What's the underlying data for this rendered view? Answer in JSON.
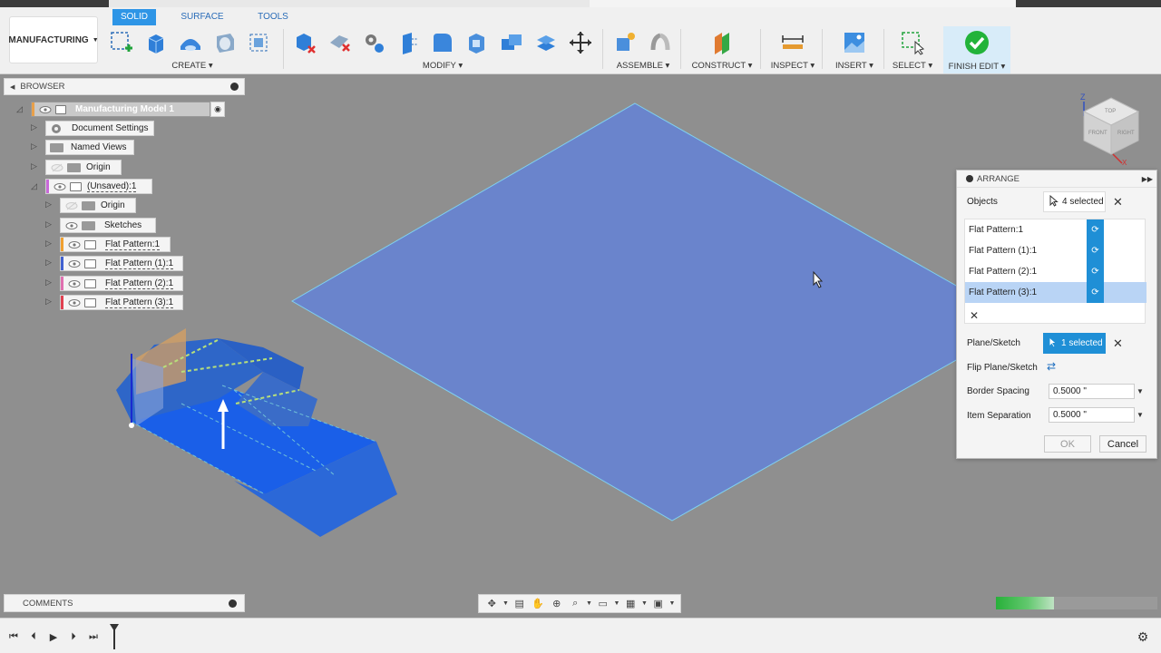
{
  "workspace": {
    "label": "MANUFACTURING"
  },
  "tabs": [
    {
      "label": "SOLID",
      "active": true
    },
    {
      "label": "SURFACE",
      "active": false
    },
    {
      "label": "TOOLS",
      "active": false
    }
  ],
  "groups": {
    "create": "CREATE ▾",
    "modify": "MODIFY ▾",
    "assemble": "ASSEMBLE ▾",
    "construct": "CONSTRUCT ▾",
    "inspect": "INSPECT ▾",
    "insert": "INSERT ▾",
    "select": "SELECT ▾",
    "finish": "FINISH EDIT ▾"
  },
  "browser": {
    "title": "BROWSER",
    "root": "Manufacturing Model 1",
    "items": [
      {
        "label": "Document Settings"
      },
      {
        "label": "Named Views"
      },
      {
        "label": "Origin"
      },
      {
        "label": "(Unsaved):1"
      },
      {
        "label": "Origin"
      },
      {
        "label": "Sketches"
      },
      {
        "label": "Flat Pattern:1",
        "color": "#f0a030"
      },
      {
        "label": "Flat Pattern (1):1",
        "color": "#4060d0"
      },
      {
        "label": "Flat Pattern (2):1",
        "color": "#e070b0"
      },
      {
        "label": "Flat Pattern (3):1",
        "color": "#e04050"
      }
    ]
  },
  "comments": {
    "title": "COMMENTS"
  },
  "arrange": {
    "title": "ARRANGE",
    "objects_label": "Objects",
    "objects_value": "4 selected",
    "objects": [
      {
        "label": "Flat Pattern:1",
        "highlighted": false
      },
      {
        "label": "Flat Pattern (1):1",
        "highlighted": false
      },
      {
        "label": "Flat Pattern (2):1",
        "highlighted": false
      },
      {
        "label": "Flat Pattern (3):1",
        "highlighted": true
      }
    ],
    "plane_label": "Plane/Sketch",
    "plane_value": "1 selected",
    "flip_label": "Flip Plane/Sketch",
    "border_label": "Border Spacing",
    "border_value": "0.5000 \"",
    "item_label": "Item Separation",
    "item_value": "0.5000 \"",
    "ok_label": "OK",
    "cancel_label": "Cancel"
  },
  "viewcube": {
    "top": "TOP",
    "front": "FRONT",
    "right": "RIGHT",
    "z": "Z",
    "x": "X"
  },
  "progress": {
    "fraction": 0.36
  },
  "colors": {
    "accent": "#2e95e6",
    "plane": "#6a84cc",
    "part": "#2a6ff0"
  }
}
